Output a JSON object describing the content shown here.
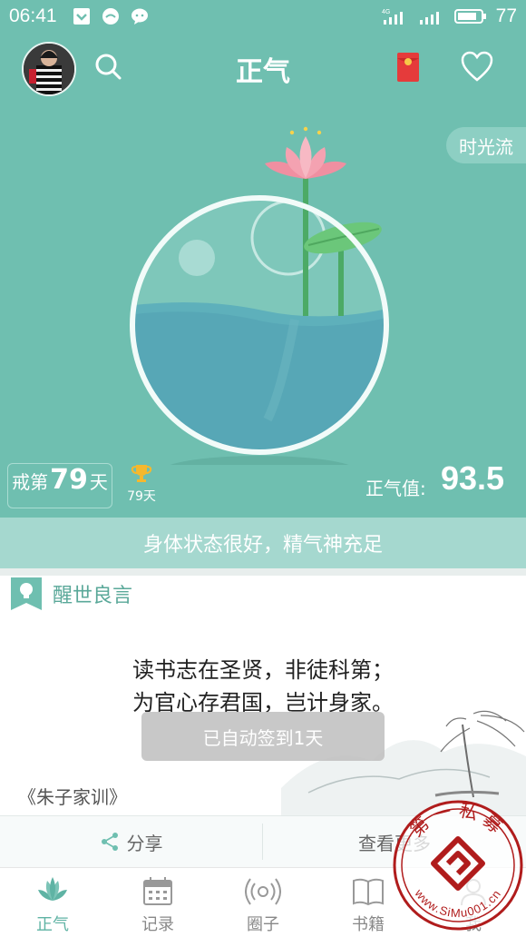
{
  "status": {
    "time": "06:41",
    "battery": "77",
    "network": "4G"
  },
  "header": {
    "title": "正气"
  },
  "hero": {
    "timeflow_label": "时光流",
    "streak_prefix": "戒第",
    "streak_days": "79",
    "streak_suffix": "天",
    "trophy_days": "79天",
    "score_label": "正气值:",
    "score_value": "93.5",
    "state_text": "身体状态很好，精气神充足"
  },
  "quote": {
    "section_title": "醒世良言",
    "line1": "读书志在圣贤，非徒科第；",
    "line2": "为官心存君国，岂计身家。",
    "source": "《朱子家训》",
    "toast": "已自动签到1天"
  },
  "actions": {
    "share": "分享",
    "more": "查看更多"
  },
  "tabs": [
    {
      "label": "正气",
      "icon": "lotus-icon",
      "active": true
    },
    {
      "label": "记录",
      "icon": "calendar-icon",
      "active": false
    },
    {
      "label": "圈子",
      "icon": "broadcast-icon",
      "active": false
    },
    {
      "label": "书籍",
      "icon": "book-icon",
      "active": false
    },
    {
      "label": "我",
      "icon": "user-icon",
      "active": false
    }
  ],
  "watermark": {
    "top": "第一私募",
    "url": "www.SiMu001.cn"
  },
  "colors": {
    "primary": "#6fbfb0",
    "state_bar": "#a5d8cf",
    "accent": "#5fb3a4"
  }
}
